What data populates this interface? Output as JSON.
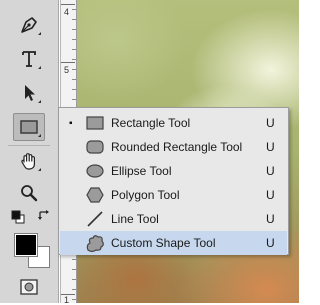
{
  "ruler": {
    "labels": [
      "4",
      "5",
      "6",
      "7",
      "8",
      "9",
      "1"
    ]
  },
  "toolbar": {
    "tools": [
      "pen-tool",
      "type-tool",
      "path-selection-tool",
      "rectangle-tool",
      "hand-tool",
      "zoom-tool",
      "default-colors",
      "swap-colors",
      "foreground-color",
      "background-color",
      "quick-mask-mode"
    ],
    "foreground_color": "#000000",
    "background_color": "#ffffff"
  },
  "flyout": {
    "items": [
      {
        "label": "Rectangle Tool",
        "shortcut": "U",
        "icon": "rectangle-icon",
        "selected": true
      },
      {
        "label": "Rounded Rectangle Tool",
        "shortcut": "U",
        "icon": "rounded-rectangle-icon",
        "selected": false
      },
      {
        "label": "Ellipse Tool",
        "shortcut": "U",
        "icon": "ellipse-icon",
        "selected": false
      },
      {
        "label": "Polygon Tool",
        "shortcut": "U",
        "icon": "polygon-icon",
        "selected": false
      },
      {
        "label": "Line Tool",
        "shortcut": "U",
        "icon": "line-icon",
        "selected": false
      },
      {
        "label": "Custom Shape Tool",
        "shortcut": "U",
        "icon": "custom-shape-icon",
        "selected": false,
        "highlighted": true
      }
    ],
    "selected_marker": "▪",
    "highlight_color": "#c7d8ee"
  }
}
